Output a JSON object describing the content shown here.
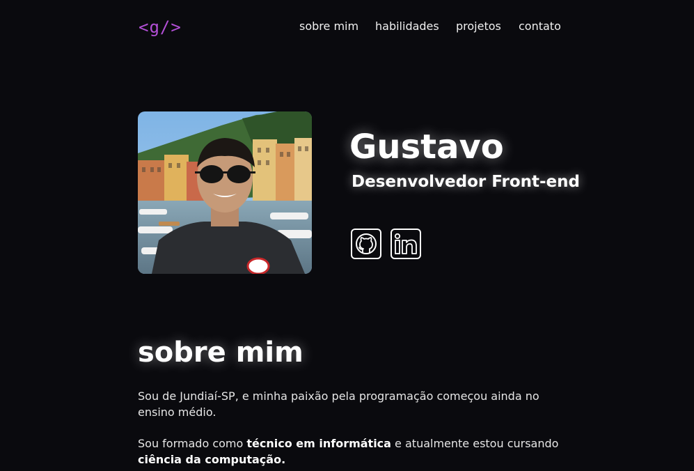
{
  "header": {
    "logo": "<g/>",
    "nav": [
      {
        "label": "sobre mim"
      },
      {
        "label": "habilidades"
      },
      {
        "label": "projetos"
      },
      {
        "label": "contato"
      }
    ]
  },
  "hero": {
    "name": "Gustavo",
    "role": "Desenvolvedor Front-end",
    "social": [
      {
        "icon": "github-icon"
      },
      {
        "icon": "linkedin-icon"
      }
    ]
  },
  "about": {
    "title": "sobre mim",
    "p1": "Sou de Jundiaí-SP, e minha paixão pela programação começou ainda no ensino médio.",
    "p2_prefix": "Sou formado como ",
    "p2_bold1": "técnico em informática",
    "p2_middle": " e atualmente estou cursando ",
    "p2_bold2": "ciência da computação."
  },
  "colors": {
    "background": "#0a0a0e",
    "logo": "#b34fd6",
    "text": "#ffffff"
  }
}
